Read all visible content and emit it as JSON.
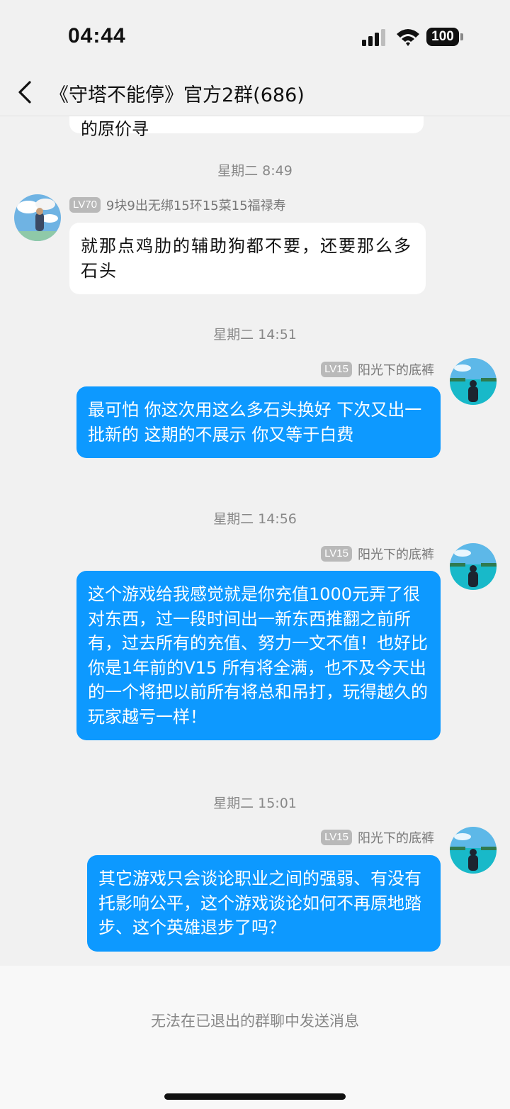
{
  "status": {
    "time": "04:44",
    "battery": "100"
  },
  "nav": {
    "title": "《守塔不能停》官方2群(686)"
  },
  "partial_bubble_text": "的原价寻",
  "messages": [
    {
      "timestamp": "星期二 8:49",
      "level": "LV70",
      "sender": "9块9出无绑15环15菜15福禄寿",
      "text": "就那点鸡肋的辅助狗都不要，还要那么多石头",
      "direction": "in"
    },
    {
      "timestamp": "星期二 14:51",
      "level": "LV15",
      "sender": "阳光下的底裤",
      "text": "最可怕 你这次用这么多石头换好 下次又出一批新的  这期的不展示 你又等于白费",
      "direction": "out"
    },
    {
      "timestamp": "星期二 14:56",
      "level": "LV15",
      "sender": "阳光下的底裤",
      "text": "这个游戏给我感觉就是你充值1000元弄了很对东西，过一段时间出一新东西推翻之前所有，过去所有的充值、努力一文不值！也好比你是1年前的V15 所有将全满，也不及今天出的一个将把以前所有将总和吊打，玩得越久的玩家越亏一样！",
      "direction": "out"
    },
    {
      "timestamp": "星期二 15:01",
      "level": "LV15",
      "sender": "阳光下的底裤",
      "text": "其它游戏只会谈论职业之间的强弱、有没有托影响公平，这个游戏谈论如何不再原地踏步、这个英雄退步了吗？",
      "direction": "out"
    }
  ],
  "footer": {
    "notice": "无法在已退出的群聊中发送消息"
  },
  "colors": {
    "outgoing_bubble": "#0d99ff",
    "incoming_bubble": "#ffffff",
    "background": "#f1f1f1"
  }
}
